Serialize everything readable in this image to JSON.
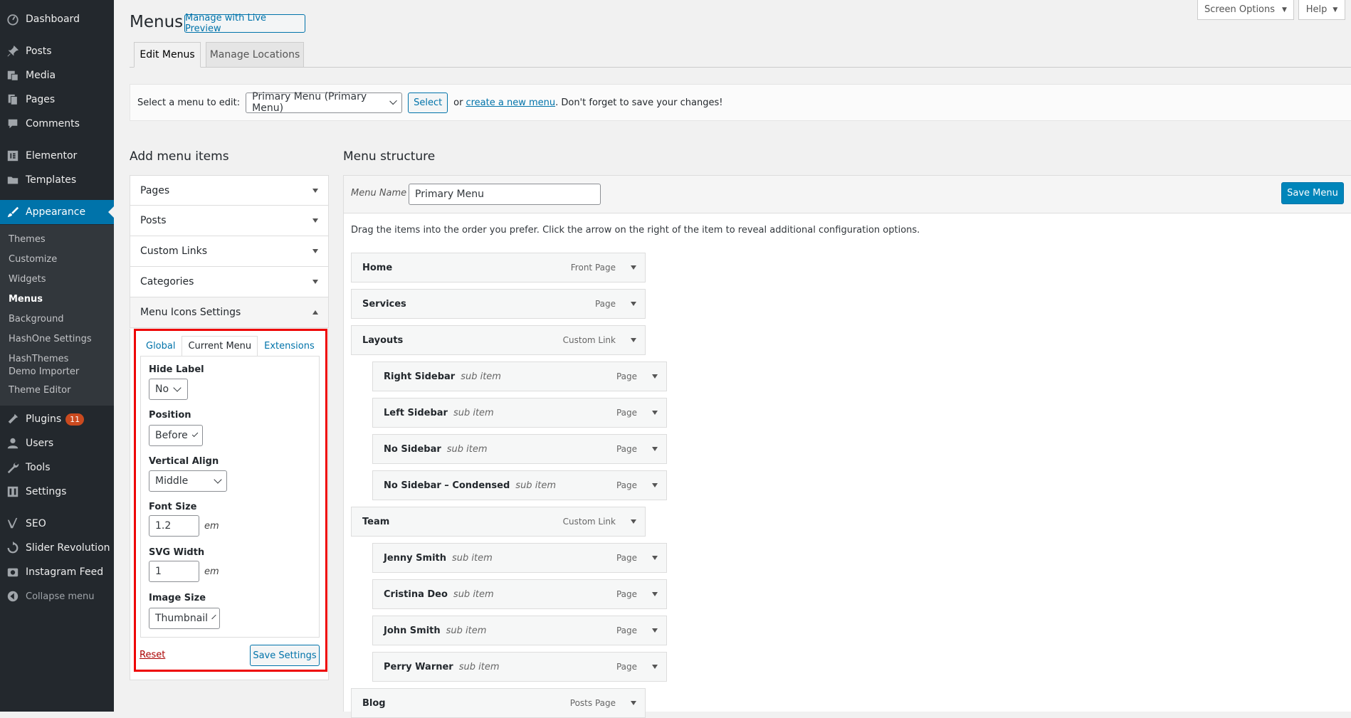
{
  "sidebar": {
    "items": [
      {
        "label": "Dashboard",
        "icon": "dashboard-icon"
      },
      {
        "label": "Posts",
        "icon": "pin-icon"
      },
      {
        "label": "Media",
        "icon": "media-icon"
      },
      {
        "label": "Pages",
        "icon": "pages-icon"
      },
      {
        "label": "Comments",
        "icon": "comment-icon"
      },
      {
        "label": "Elementor",
        "icon": "elementor-icon"
      },
      {
        "label": "Templates",
        "icon": "folder-icon"
      },
      {
        "label": "Appearance",
        "icon": "brush-icon"
      },
      {
        "label": "Plugins",
        "icon": "plugin-icon",
        "badge": "11"
      },
      {
        "label": "Users",
        "icon": "user-icon"
      },
      {
        "label": "Tools",
        "icon": "wrench-icon"
      },
      {
        "label": "Settings",
        "icon": "settings-icon"
      },
      {
        "label": "SEO",
        "icon": "yoast-icon"
      },
      {
        "label": "Slider Revolution",
        "icon": "refresh-icon"
      },
      {
        "label": "Instagram Feed",
        "icon": "instagram-icon"
      },
      {
        "label": "Collapse menu",
        "icon": "collapse-icon"
      }
    ],
    "submenu": [
      "Themes",
      "Customize",
      "Widgets",
      "Menus",
      "Background",
      "HashOne Settings",
      "HashThemes Demo Importer",
      "Theme Editor"
    ]
  },
  "header": {
    "title": "Menus",
    "live_preview": "Manage with Live Preview",
    "screen_options": "Screen Options",
    "help": "Help",
    "tabs": [
      "Edit Menus",
      "Manage Locations"
    ]
  },
  "manage": {
    "label": "Select a menu to edit:",
    "selected": "Primary Menu (Primary Menu)",
    "select_button": "Select",
    "or": "or",
    "create_link": "create a new menu",
    "tail": ". Don't forget to save your changes!"
  },
  "add_items": {
    "heading": "Add menu items",
    "sections": [
      "Pages",
      "Posts",
      "Custom Links",
      "Categories",
      "Menu Icons Settings"
    ],
    "icon_tabs": [
      "Global",
      "Current Menu",
      "Extensions"
    ],
    "fields": {
      "hide_label": {
        "label": "Hide Label",
        "value": "No"
      },
      "position": {
        "label": "Position",
        "value": "Before"
      },
      "vertical_align": {
        "label": "Vertical Align",
        "value": "Middle"
      },
      "font_size": {
        "label": "Font Size",
        "value": "1.2",
        "unit": "em"
      },
      "svg_width": {
        "label": "SVG Width",
        "value": "1",
        "unit": "em"
      },
      "image_size": {
        "label": "Image Size",
        "value": "Thumbnail"
      }
    },
    "reset": "Reset",
    "save_settings": "Save Settings"
  },
  "structure": {
    "heading": "Menu structure",
    "menu_name_label": "Menu Name",
    "menu_name_value": "Primary Menu",
    "save_menu": "Save Menu",
    "instructions": "Drag the items into the order you prefer. Click the arrow on the right of the item to reveal additional configuration options.",
    "items": [
      {
        "title": "Home",
        "sub": "",
        "type": "Front Page",
        "depth": 0
      },
      {
        "title": "Services",
        "sub": "",
        "type": "Page",
        "depth": 0
      },
      {
        "title": "Layouts",
        "sub": "",
        "type": "Custom Link",
        "depth": 0
      },
      {
        "title": "Right Sidebar",
        "sub": "sub item",
        "type": "Page",
        "depth": 1
      },
      {
        "title": "Left Sidebar",
        "sub": "sub item",
        "type": "Page",
        "depth": 1
      },
      {
        "title": "No Sidebar",
        "sub": "sub item",
        "type": "Page",
        "depth": 1
      },
      {
        "title": "No Sidebar – Condensed",
        "sub": "sub item",
        "type": "Page",
        "depth": 1
      },
      {
        "title": "Team",
        "sub": "",
        "type": "Custom Link",
        "depth": 0
      },
      {
        "title": "Jenny Smith",
        "sub": "sub item",
        "type": "Page",
        "depth": 1
      },
      {
        "title": "Cristina Deo",
        "sub": "sub item",
        "type": "Page",
        "depth": 1
      },
      {
        "title": "John Smith",
        "sub": "sub item",
        "type": "Page",
        "depth": 1
      },
      {
        "title": "Perry Warner",
        "sub": "sub item",
        "type": "Page",
        "depth": 1
      },
      {
        "title": "Blog",
        "sub": "",
        "type": "Posts Page",
        "depth": 0
      }
    ]
  },
  "colors": {
    "accent": "#0073aa",
    "sidebar": "#23282d",
    "highlight": "#e00000",
    "badge": "#ca4a1f"
  }
}
